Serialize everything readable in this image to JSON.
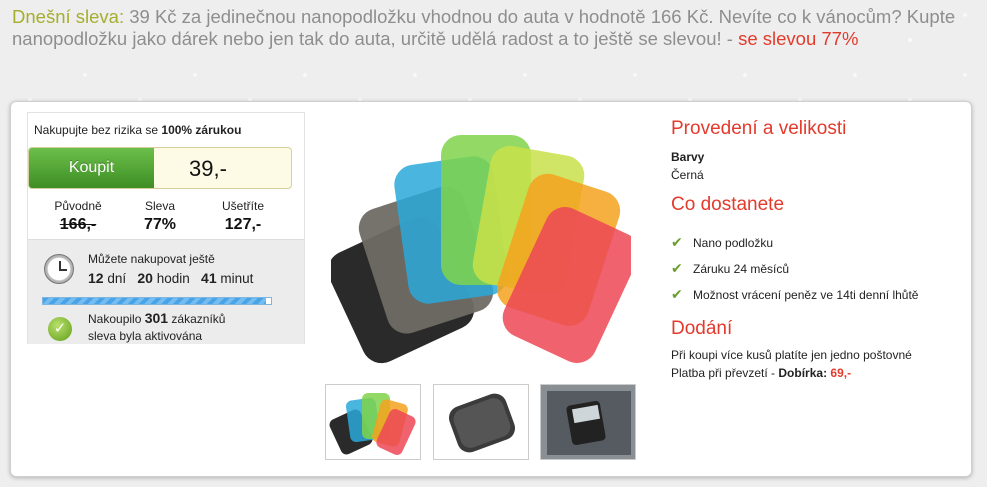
{
  "headline": {
    "lead": "Dnešní sleva:",
    "text": " 39 Kč za jedinečnou nanopodložku vhodnou do auta v hodnotě 166 Kč. Nevíte co k vánocům? Kupte nanopodložku jako dárek nebo jen tak do auta, určitě udělá radost a to ještě se slevou! - ",
    "hot": "se slevou 77%"
  },
  "buy": {
    "guarantee_prefix": "Nakupujte bez rizika se ",
    "guarantee_bold": "100% zárukou",
    "button": "Koupit",
    "price": "39,-"
  },
  "stats": {
    "original_label": "Původně",
    "original_value": "166,-",
    "discount_label": "Sleva",
    "discount_value": "77%",
    "save_label": "Ušetříte",
    "save_value": "127,-"
  },
  "timer": {
    "line1": "Můžete nakupovat ještě",
    "days": "12",
    "days_unit": "dní",
    "hours": "20",
    "hours_unit": "hodin",
    "minutes": "41",
    "minutes_unit": "minut",
    "progress": 0.98,
    "bought_prefix": "Nakoupilo",
    "bought_count": "301",
    "bought_suffix": "zákazníků",
    "activated": "sleva byla aktivována"
  },
  "right": {
    "variant_heading": "Provedení a velikosti",
    "color_label": "Barvy",
    "color_value": "Černá",
    "get_heading": "Co dostanete",
    "items": [
      "Nano podložku",
      "Záruku 24 měsíců",
      "Možnost vrácení peněz ve 14ti denní lhůtě"
    ],
    "delivery_heading": "Dodání",
    "delivery_line1": "Při koupi více kusů platíte jen jedno poštovné",
    "delivery_line2_prefix": "Platba při převzetí - ",
    "cod_label": "Dobírka:",
    "cod_price": "69,-"
  },
  "colors": {
    "accent_red": "#e33a2c",
    "lead_green": "#a6ae2e",
    "buy_green": "#4a9d2e"
  },
  "icons": [
    "clock-icon",
    "check-icon",
    "checkmark-icon"
  ]
}
